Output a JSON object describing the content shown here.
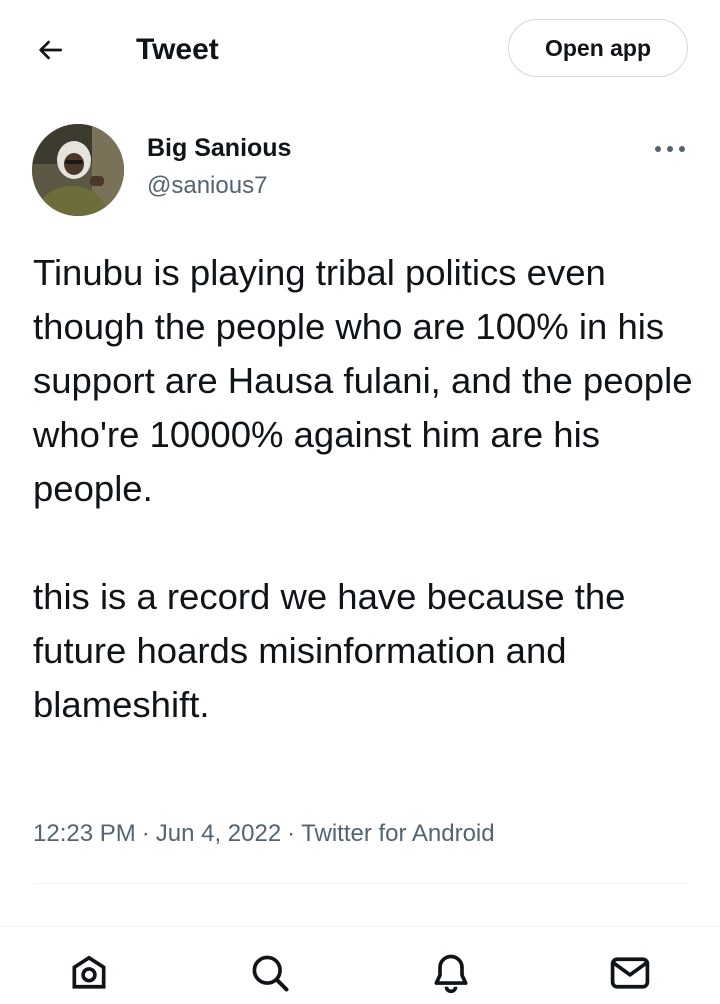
{
  "header": {
    "back_icon": "arrow-left-icon",
    "title": "Tweet",
    "open_app_label": "Open app"
  },
  "author": {
    "display_name": "Big Sanious",
    "handle": "@sanious7",
    "more_icon": "more-dots-icon"
  },
  "tweet": {
    "paragraphs": [
      "Tinubu is playing tribal politics even though the people who are 100% in his support are Hausa fulani, and the people who're 10000% against him are his people.",
      "this is a record we have because the future hoards misinformation and blameshift."
    ],
    "time": "12:23 PM",
    "date": "Jun 4, 2022",
    "source": "Twitter for Android",
    "separator": "·"
  },
  "bottom_nav": {
    "items": [
      {
        "icon": "home-icon"
      },
      {
        "icon": "search-icon"
      },
      {
        "icon": "notifications-icon"
      },
      {
        "icon": "messages-icon"
      }
    ]
  },
  "colors": {
    "text_primary": "#0f1419",
    "text_secondary": "#536471",
    "border": "#cfd9de",
    "divider": "#eff3f4"
  }
}
